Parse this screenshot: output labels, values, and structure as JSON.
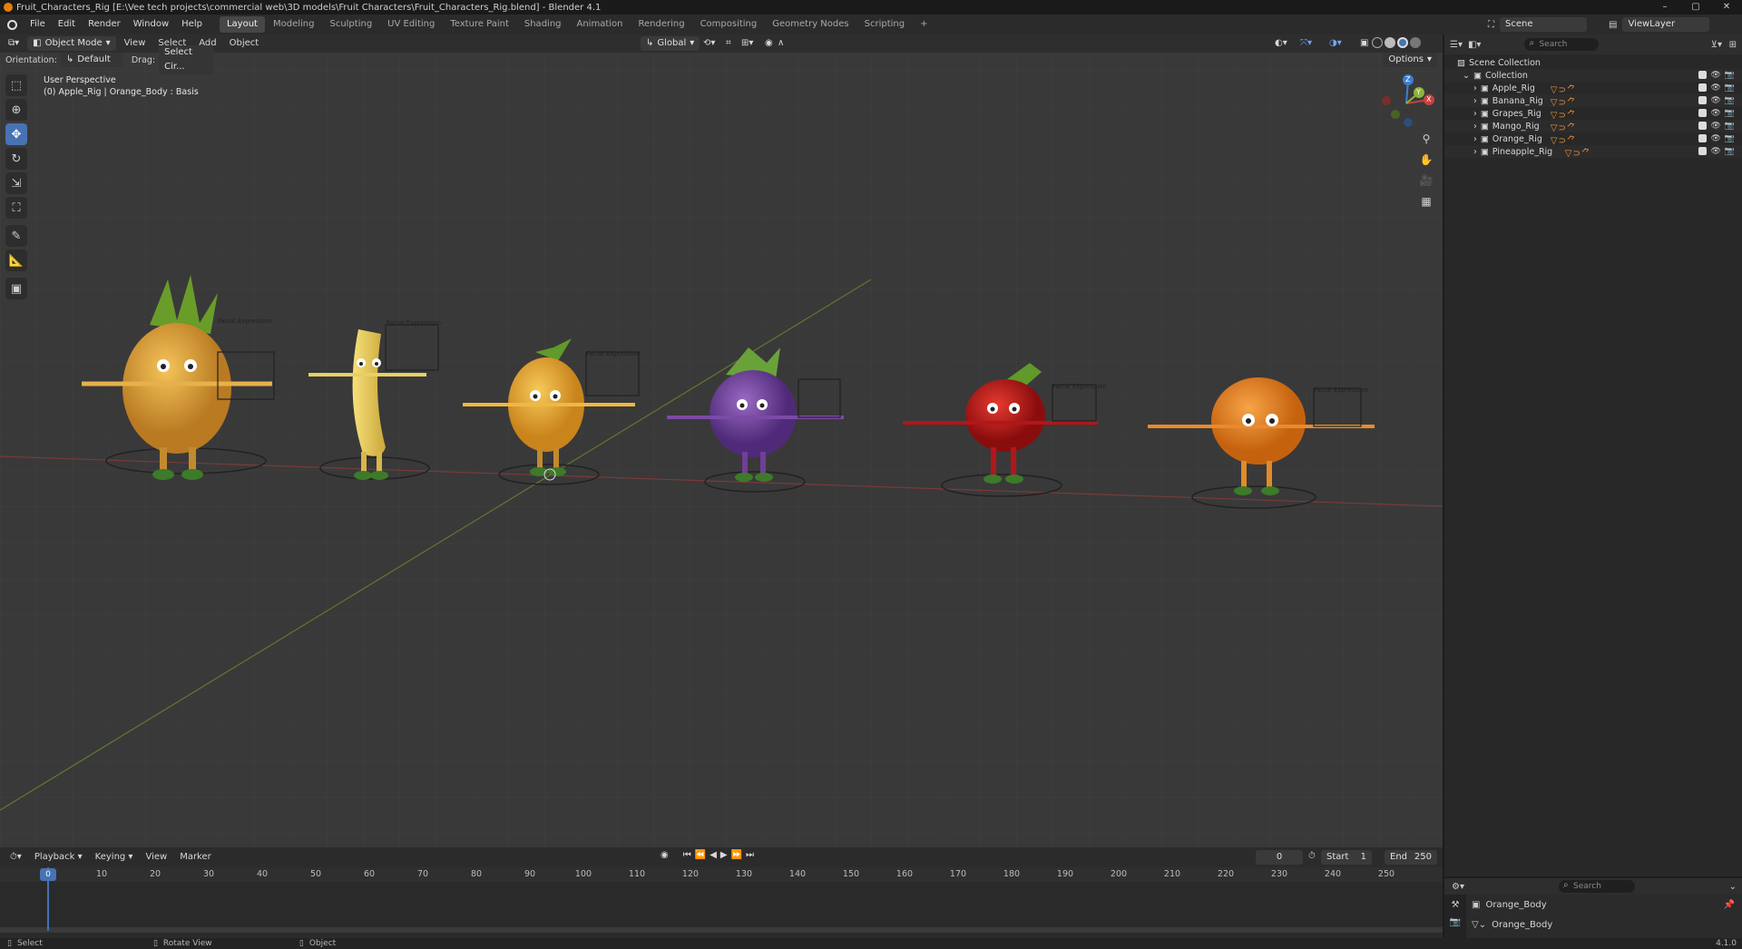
{
  "window": {
    "title": "Fruit_Characters_Rig [E:\\Vee tech projects\\commercial web\\3D models\\Fruit Characters\\Fruit_Characters_Rig.blend] - Blender 4.1"
  },
  "menus": [
    "File",
    "Edit",
    "Render",
    "Window",
    "Help"
  ],
  "workspaces": [
    "Layout",
    "Modeling",
    "Sculpting",
    "UV Editing",
    "Texture Paint",
    "Shading",
    "Animation",
    "Rendering",
    "Compositing",
    "Geometry Nodes",
    "Scripting"
  ],
  "active_workspace": "Layout",
  "scene": {
    "label": "Scene",
    "view_layer": "ViewLayer"
  },
  "viewport": {
    "mode": "Object Mode",
    "menus": [
      "View",
      "Select",
      "Add",
      "Object"
    ],
    "transform": "Global",
    "orientation_label": "Orientation:",
    "orientation_value": "Default",
    "drag_label": "Drag:",
    "drag_value": "Select Cir...",
    "options_label": "Options",
    "perspective": "User Perspective",
    "active_info": "(0) Apple_Rig | Orange_Body : Basis",
    "gizmo_axes": [
      "Z",
      "Y",
      "X"
    ],
    "fruit_label": "Facial Expression"
  },
  "characters": [
    {
      "name": "Pineapple",
      "color": "#e8a83a"
    },
    {
      "name": "Banana",
      "color": "#efd56a"
    },
    {
      "name": "Mango",
      "color": "#f0b333"
    },
    {
      "name": "Grapes",
      "color": "#7a46a8"
    },
    {
      "name": "Apple",
      "color": "#c4181a"
    },
    {
      "name": "Orange",
      "color": "#f08a22"
    }
  ],
  "timeline": {
    "menus": [
      "Playback",
      "Keying",
      "View",
      "Marker"
    ],
    "current_frame": "0",
    "start_label": "Start",
    "start": "1",
    "end_label": "End",
    "end": "250",
    "ticks": [
      "0",
      "10",
      "20",
      "30",
      "40",
      "50",
      "60",
      "70",
      "80",
      "90",
      "100",
      "110",
      "120",
      "130",
      "140",
      "150",
      "160",
      "170",
      "180",
      "190",
      "200",
      "210",
      "220",
      "230",
      "240",
      "250"
    ]
  },
  "outliner": {
    "search_placeholder": "Search",
    "scene_collection": "Scene Collection",
    "collection": "Collection",
    "items": [
      "Apple_Rig",
      "Banana_Rig",
      "Grapes_Rig",
      "Mango_Rig",
      "Orange_Rig",
      "Pineapple_Rig"
    ]
  },
  "properties": {
    "search_placeholder": "Search",
    "object": "Orange_Body",
    "mesh": "Orange_Body"
  },
  "status": {
    "select": "Select",
    "rotate": "Rotate View",
    "object": "Object",
    "version": "4.1.0"
  },
  "colors": {
    "accent": "#4772b3",
    "blender_orange": "#e87d0d",
    "x_axis": "#c8403f",
    "y_axis": "#8cb43a",
    "z_axis": "#3b7fd3"
  }
}
